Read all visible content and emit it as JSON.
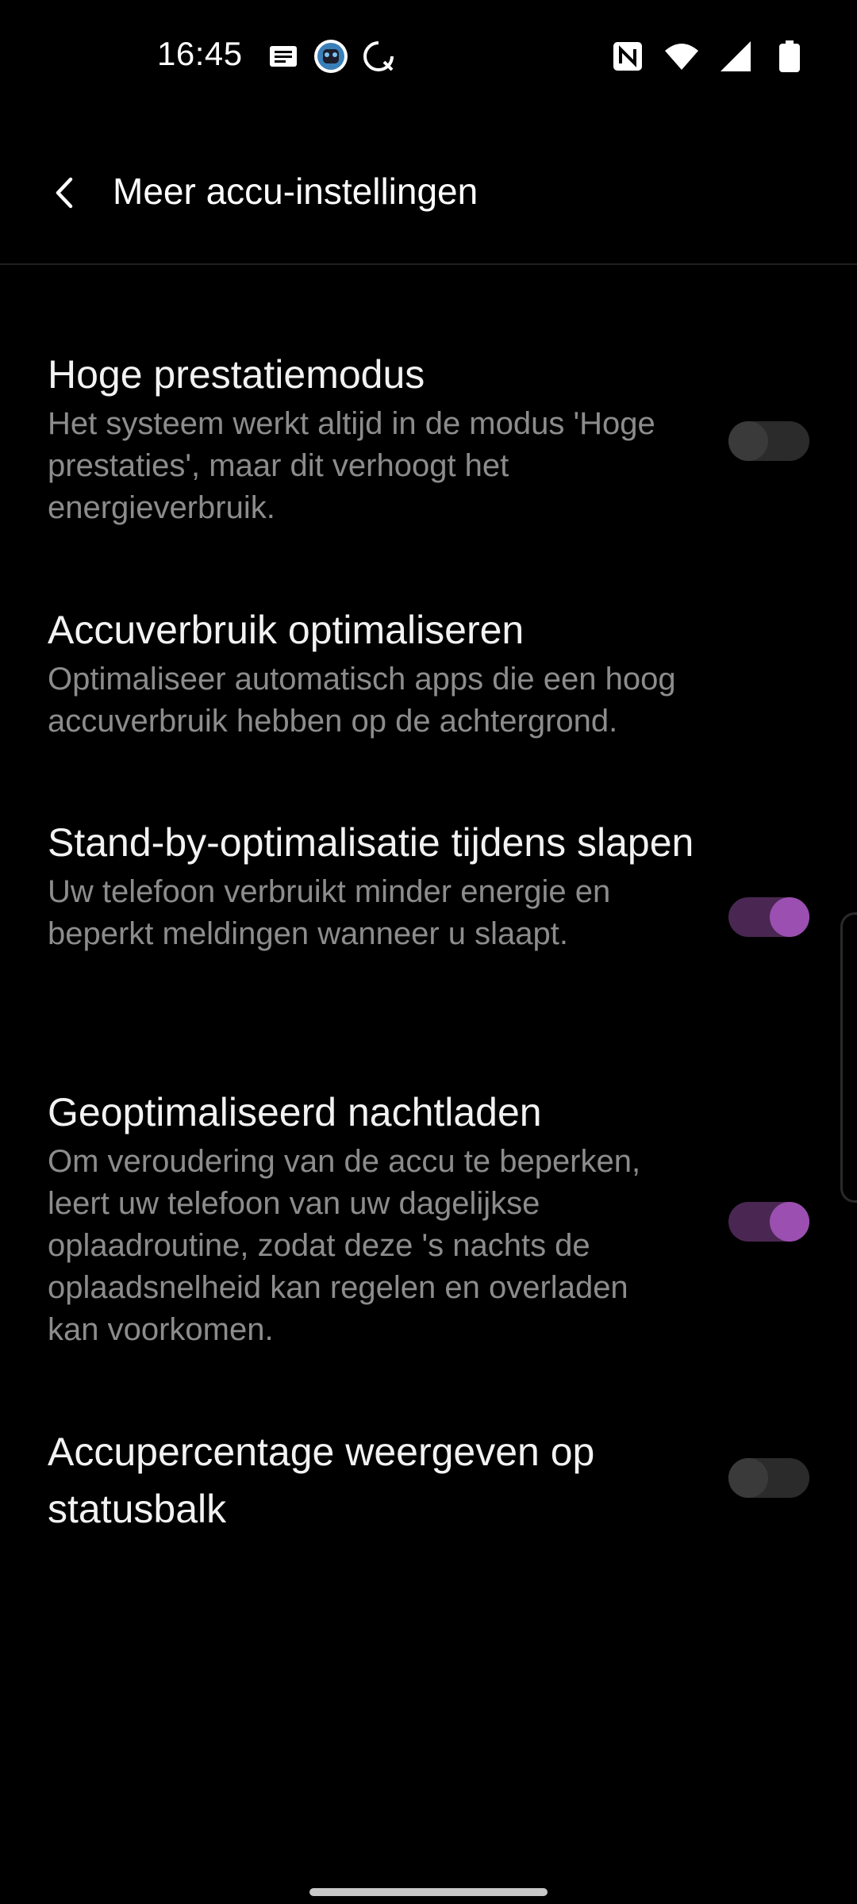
{
  "status_bar": {
    "time": "16:45",
    "left_icons": [
      "message-icon",
      "app-avatar-icon",
      "sync-icon"
    ],
    "right_icons": [
      "nfc-icon",
      "wifi-icon",
      "cell-signal-icon",
      "battery-icon"
    ]
  },
  "header": {
    "title": "Meer accu-instellingen",
    "back_icon": "chevron-left-icon"
  },
  "settings": [
    {
      "title": "Hoge prestatiemodus",
      "description": "Het systeem werkt altijd in de modus 'Hoge prestaties', maar dit verhoogt het energieverbruik.",
      "toggle": false
    },
    {
      "title": "Accuverbruik optimaliseren",
      "description": "Optimaliseer automatisch apps die een hoog accuverbruik hebben op de achtergrond."
    },
    {
      "title": "Stand-by-optimalisatie tijdens slapen",
      "description": "Uw telefoon verbruikt minder energie en beperkt meldingen wanneer u slaapt.",
      "toggle": true
    },
    {
      "title": "Geoptimaliseerd nachtladen",
      "description": "Om veroudering van de accu te beperken, leert uw telefoon van uw dagelijkse oplaadroutine, zodat deze 's nachts de oplaadsnelheid kan regelen en overladen kan voorkomen.",
      "toggle": true
    },
    {
      "title": "Accupercentage weergeven op statusbalk",
      "toggle": false
    }
  ],
  "colors": {
    "background": "#000000",
    "accent": "#9b4fb0",
    "accent_track": "#4a2752",
    "secondary_text": "#8c8c8c"
  }
}
